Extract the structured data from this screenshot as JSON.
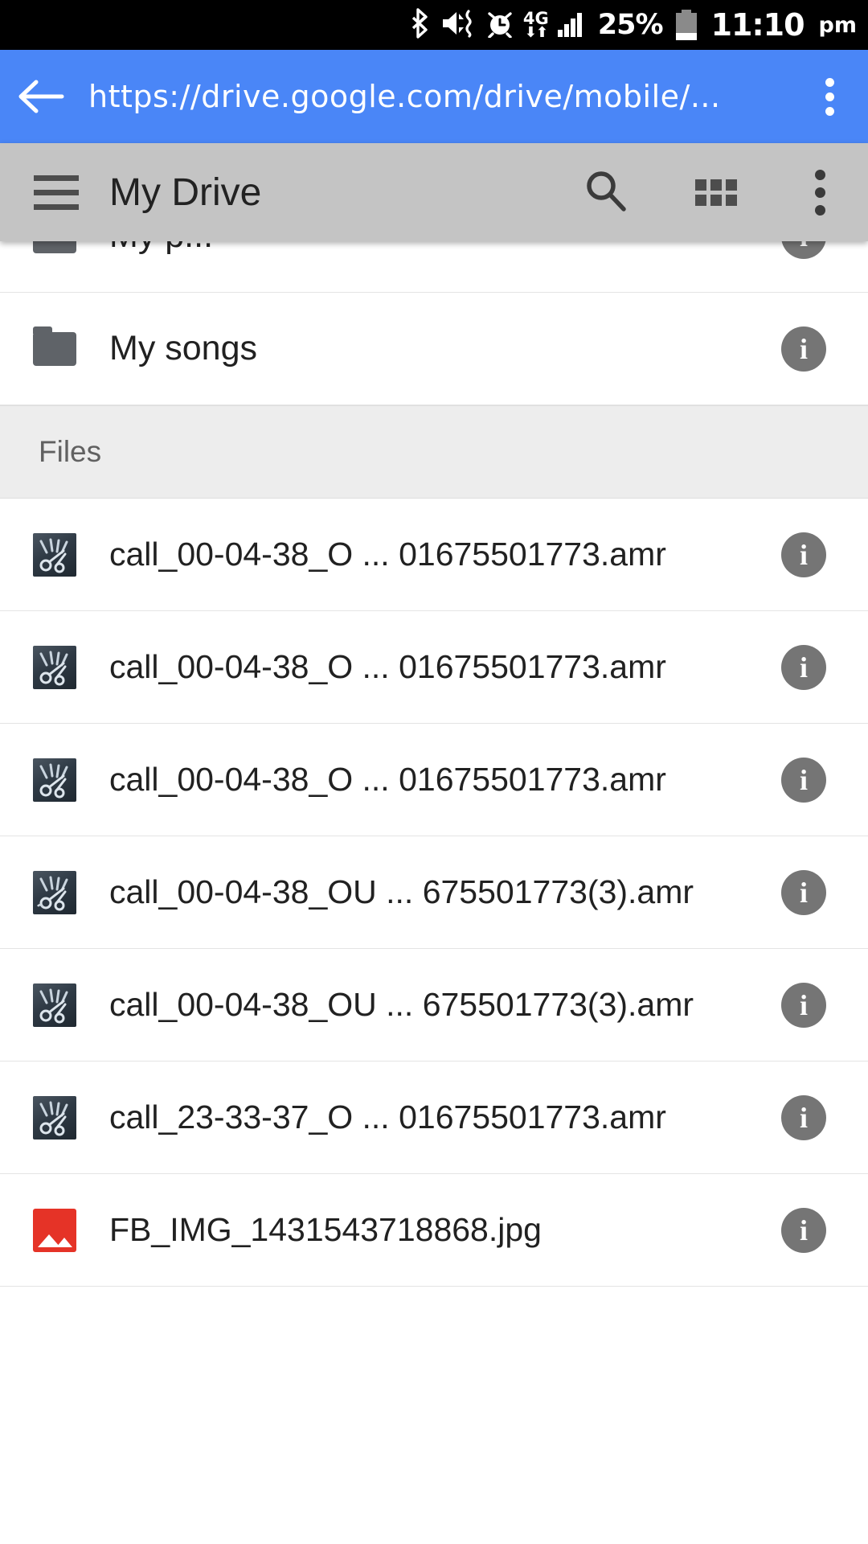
{
  "status_bar": {
    "icons": [
      "bluetooth-icon",
      "mute-vibrate-icon",
      "alarm-icon",
      "network-4g-icon",
      "signal-bars-icon",
      "battery-icon"
    ],
    "network_label": "4G",
    "battery_percent": "25%",
    "clock": "11:10",
    "am_pm": "pm",
    "signal_bars": 4,
    "battery_level": 25
  },
  "browser": {
    "back_label": "Back",
    "url": "https://drive.google.com/drive/mobile/...",
    "overflow_label": "More options"
  },
  "app_bar": {
    "menu_label": "Navigation menu",
    "title": "My Drive",
    "search_label": "Search",
    "grid_view_label": "Grid view",
    "overflow_label": "More options"
  },
  "colors": {
    "url_bar": "#4a86f7",
    "app_bar": "#c4c4c4",
    "section_header": "#ededed",
    "info_button": "#757575",
    "folder_icon": "#5f6368",
    "image_thumb": "#e53327",
    "status_bar": "#000000"
  },
  "list": {
    "clipped_row": {
      "name": "My p...",
      "icon": "folder-icon"
    },
    "folders": [
      {
        "name": "My songs",
        "icon": "folder-icon",
        "info_label": "i"
      }
    ],
    "section_files_label": "Files",
    "files": [
      {
        "name": "call_00-04-38_O ... 01675501773.amr",
        "icon": "audio-file-thumbnail",
        "info_label": "i"
      },
      {
        "name": "call_00-04-38_O ... 01675501773.amr",
        "icon": "audio-file-thumbnail",
        "info_label": "i"
      },
      {
        "name": "call_00-04-38_O ... 01675501773.amr",
        "icon": "audio-file-thumbnail",
        "info_label": "i"
      },
      {
        "name": "call_00-04-38_OU ... 675501773(3).amr",
        "icon": "audio-file-thumbnail",
        "info_label": "i"
      },
      {
        "name": "call_00-04-38_OU ... 675501773(3).amr",
        "icon": "audio-file-thumbnail",
        "info_label": "i"
      },
      {
        "name": "call_23-33-37_O ... 01675501773.amr",
        "icon": "audio-file-thumbnail",
        "info_label": "i"
      },
      {
        "name": "FB_IMG_1431543718868.jpg",
        "icon": "image-file-thumbnail",
        "info_label": "i"
      }
    ]
  }
}
